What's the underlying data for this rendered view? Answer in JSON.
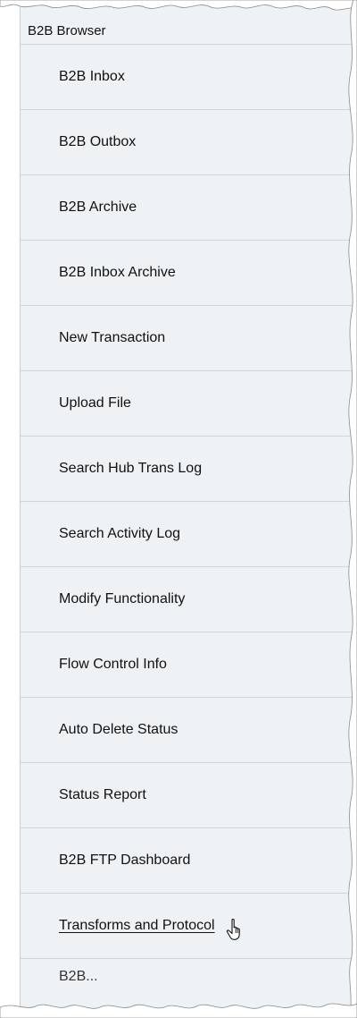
{
  "menu": {
    "header": "B2B Browser",
    "items": [
      {
        "label": "B2B Inbox"
      },
      {
        "label": "B2B Outbox"
      },
      {
        "label": "B2B Archive"
      },
      {
        "label": "B2B Inbox Archive"
      },
      {
        "label": "New Transaction"
      },
      {
        "label": "Upload File"
      },
      {
        "label": "Search Hub Trans Log"
      },
      {
        "label": "Search Activity Log"
      },
      {
        "label": "Modify Functionality"
      },
      {
        "label": "Flow Control Info"
      },
      {
        "label": "Auto Delete Status"
      },
      {
        "label": "Status Report"
      },
      {
        "label": "B2B FTP Dashboard"
      },
      {
        "label": "Transforms and Protocol"
      }
    ],
    "partial_item": "B2B..."
  },
  "icons": {
    "pointer": "hand-pointer-icon"
  },
  "colors": {
    "panel_bg": "#eef2f5",
    "divider": "#cfd5da",
    "text": "#111111"
  }
}
